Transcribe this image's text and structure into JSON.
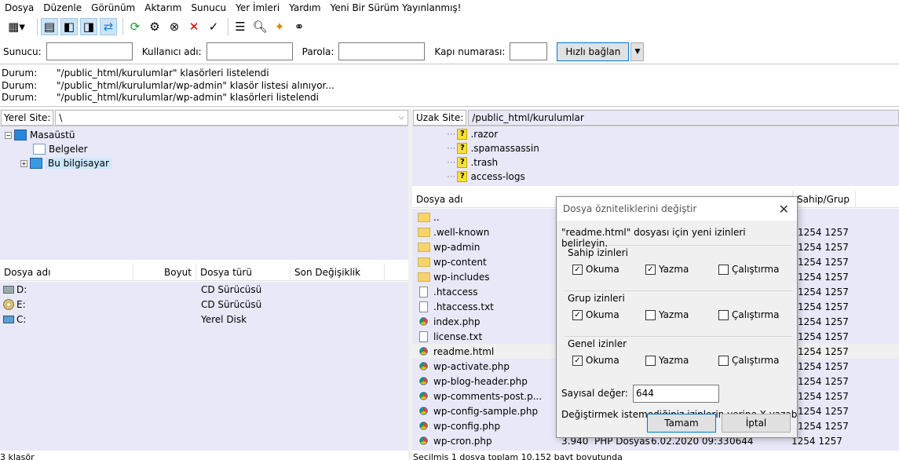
{
  "menu": [
    "Dosya",
    "Düzenle",
    "Görünüm",
    "Aktarım",
    "Sunucu",
    "Yer İmleri",
    "Yardım",
    "Yeni Bir Sürüm Yayınlanmış!"
  ],
  "quickconnect": {
    "host_label": "Sunucu:",
    "user_label": "Kullanıcı adı:",
    "pass_label": "Parola:",
    "port_label": "Kapı numarası:",
    "connect_label": "Hızlı bağlan"
  },
  "log": [
    {
      "key": "Durum:",
      "msg": "\"/public_html/kurulumlar\" klasörleri listelendi"
    },
    {
      "key": "Durum:",
      "msg": "\"/public_html/kurulumlar/wp-admin\" klasör listesi alınıyor..."
    },
    {
      "key": "Durum:",
      "msg": "\"/public_html/kurulumlar/wp-admin\" klasörleri listelendi"
    }
  ],
  "local": {
    "site_label": "Yerel Site:",
    "path": "\\",
    "tree": [
      {
        "name": "Masaüstü",
        "icon": "desktop-icon"
      },
      {
        "name": "Belgeler",
        "icon": "documents-icon"
      },
      {
        "name": "Bu bilgisayar",
        "icon": "computer-icon"
      }
    ],
    "columns": [
      "Dosya adı",
      "Boyut",
      "Dosya türü",
      "Son Değişiklik"
    ],
    "rows": [
      {
        "name": "D:",
        "size": "",
        "type": "CD Sürücüsü",
        "icon": "drive-icon"
      },
      {
        "name": "E:",
        "size": "",
        "type": "CD Sürücüsü",
        "icon": "cd-icon"
      },
      {
        "name": "C:",
        "size": "",
        "type": "Yerel Disk",
        "icon": "disk-icon"
      }
    ],
    "status": "3 klasör"
  },
  "remote": {
    "site_label": "Uzak Site:",
    "path": "/public_html/kurulumlar",
    "tree": [
      ".razor",
      ".spamassassin",
      ".trash",
      "access-logs"
    ],
    "col_name": "Dosya adı",
    "col_owner": "Sahip/Grup",
    "rows": [
      {
        "name": "..",
        "icon": "folder-icon",
        "owner": ""
      },
      {
        "name": ".well-known",
        "icon": "folder-icon",
        "owner": "1254 1257"
      },
      {
        "name": "wp-admin",
        "icon": "folder-icon",
        "owner": "1254 1257"
      },
      {
        "name": "wp-content",
        "icon": "folder-icon",
        "owner": "1254 1257"
      },
      {
        "name": "wp-includes",
        "icon": "folder-icon",
        "owner": "1254 1257"
      },
      {
        "name": ".htaccess",
        "icon": "file-icon",
        "owner": "1254 1257"
      },
      {
        "name": ".htaccess.txt",
        "icon": "file-icon",
        "owner": "1254 1257"
      },
      {
        "name": "index.php",
        "icon": "php-icon",
        "owner": "1254 1257"
      },
      {
        "name": "license.txt",
        "icon": "file-icon",
        "owner": "1254 1257"
      },
      {
        "name": "readme.html",
        "icon": "php-icon",
        "owner": "1254 1257"
      },
      {
        "name": "wp-activate.php",
        "icon": "php-icon",
        "owner": "1254 1257"
      },
      {
        "name": "wp-blog-header.php",
        "icon": "php-icon",
        "owner": "1254 1257"
      },
      {
        "name": "wp-comments-post.p...",
        "icon": "php-icon",
        "owner": "1254 1257"
      },
      {
        "name": "wp-config-sample.php",
        "icon": "php-icon",
        "owner": "1254 1257"
      },
      {
        "name": "wp-config.php",
        "icon": "php-icon",
        "owner": "1254 1257"
      },
      {
        "name": "wp-cron.php",
        "icon": "php-icon",
        "owner": "1254 1257"
      }
    ],
    "last_row_extra": {
      "size": "3.940",
      "type": "PHP Dosyası",
      "date": "6.02.2020 09:33...",
      "perm": "0644"
    },
    "status": "Seçilmiş 1 dosya toplam 10.152 bayt boyutunda"
  },
  "dialog": {
    "title": "Dosya özniteliklerini değiştir",
    "intro": "\"readme.html\" dosyası için yeni izinleri belirleyin.",
    "groups": [
      {
        "title": "Sahip izinleri",
        "read": true,
        "write": true,
        "exec": false
      },
      {
        "title": "Grup izinleri",
        "read": true,
        "write": false,
        "exec": false
      },
      {
        "title": "Genel izinler",
        "read": true,
        "write": false,
        "exec": false
      }
    ],
    "read_label": "Okuma",
    "write_label": "Yazma",
    "exec_label": "Çalıştırma",
    "numeric_label": "Sayısal değer:",
    "numeric_value": "644",
    "hint": "Değiştirmek istemediğiniz izinlerin yerine X yazabilirsiniz.",
    "ok_label": "Tamam",
    "cancel_label": "İptal"
  }
}
